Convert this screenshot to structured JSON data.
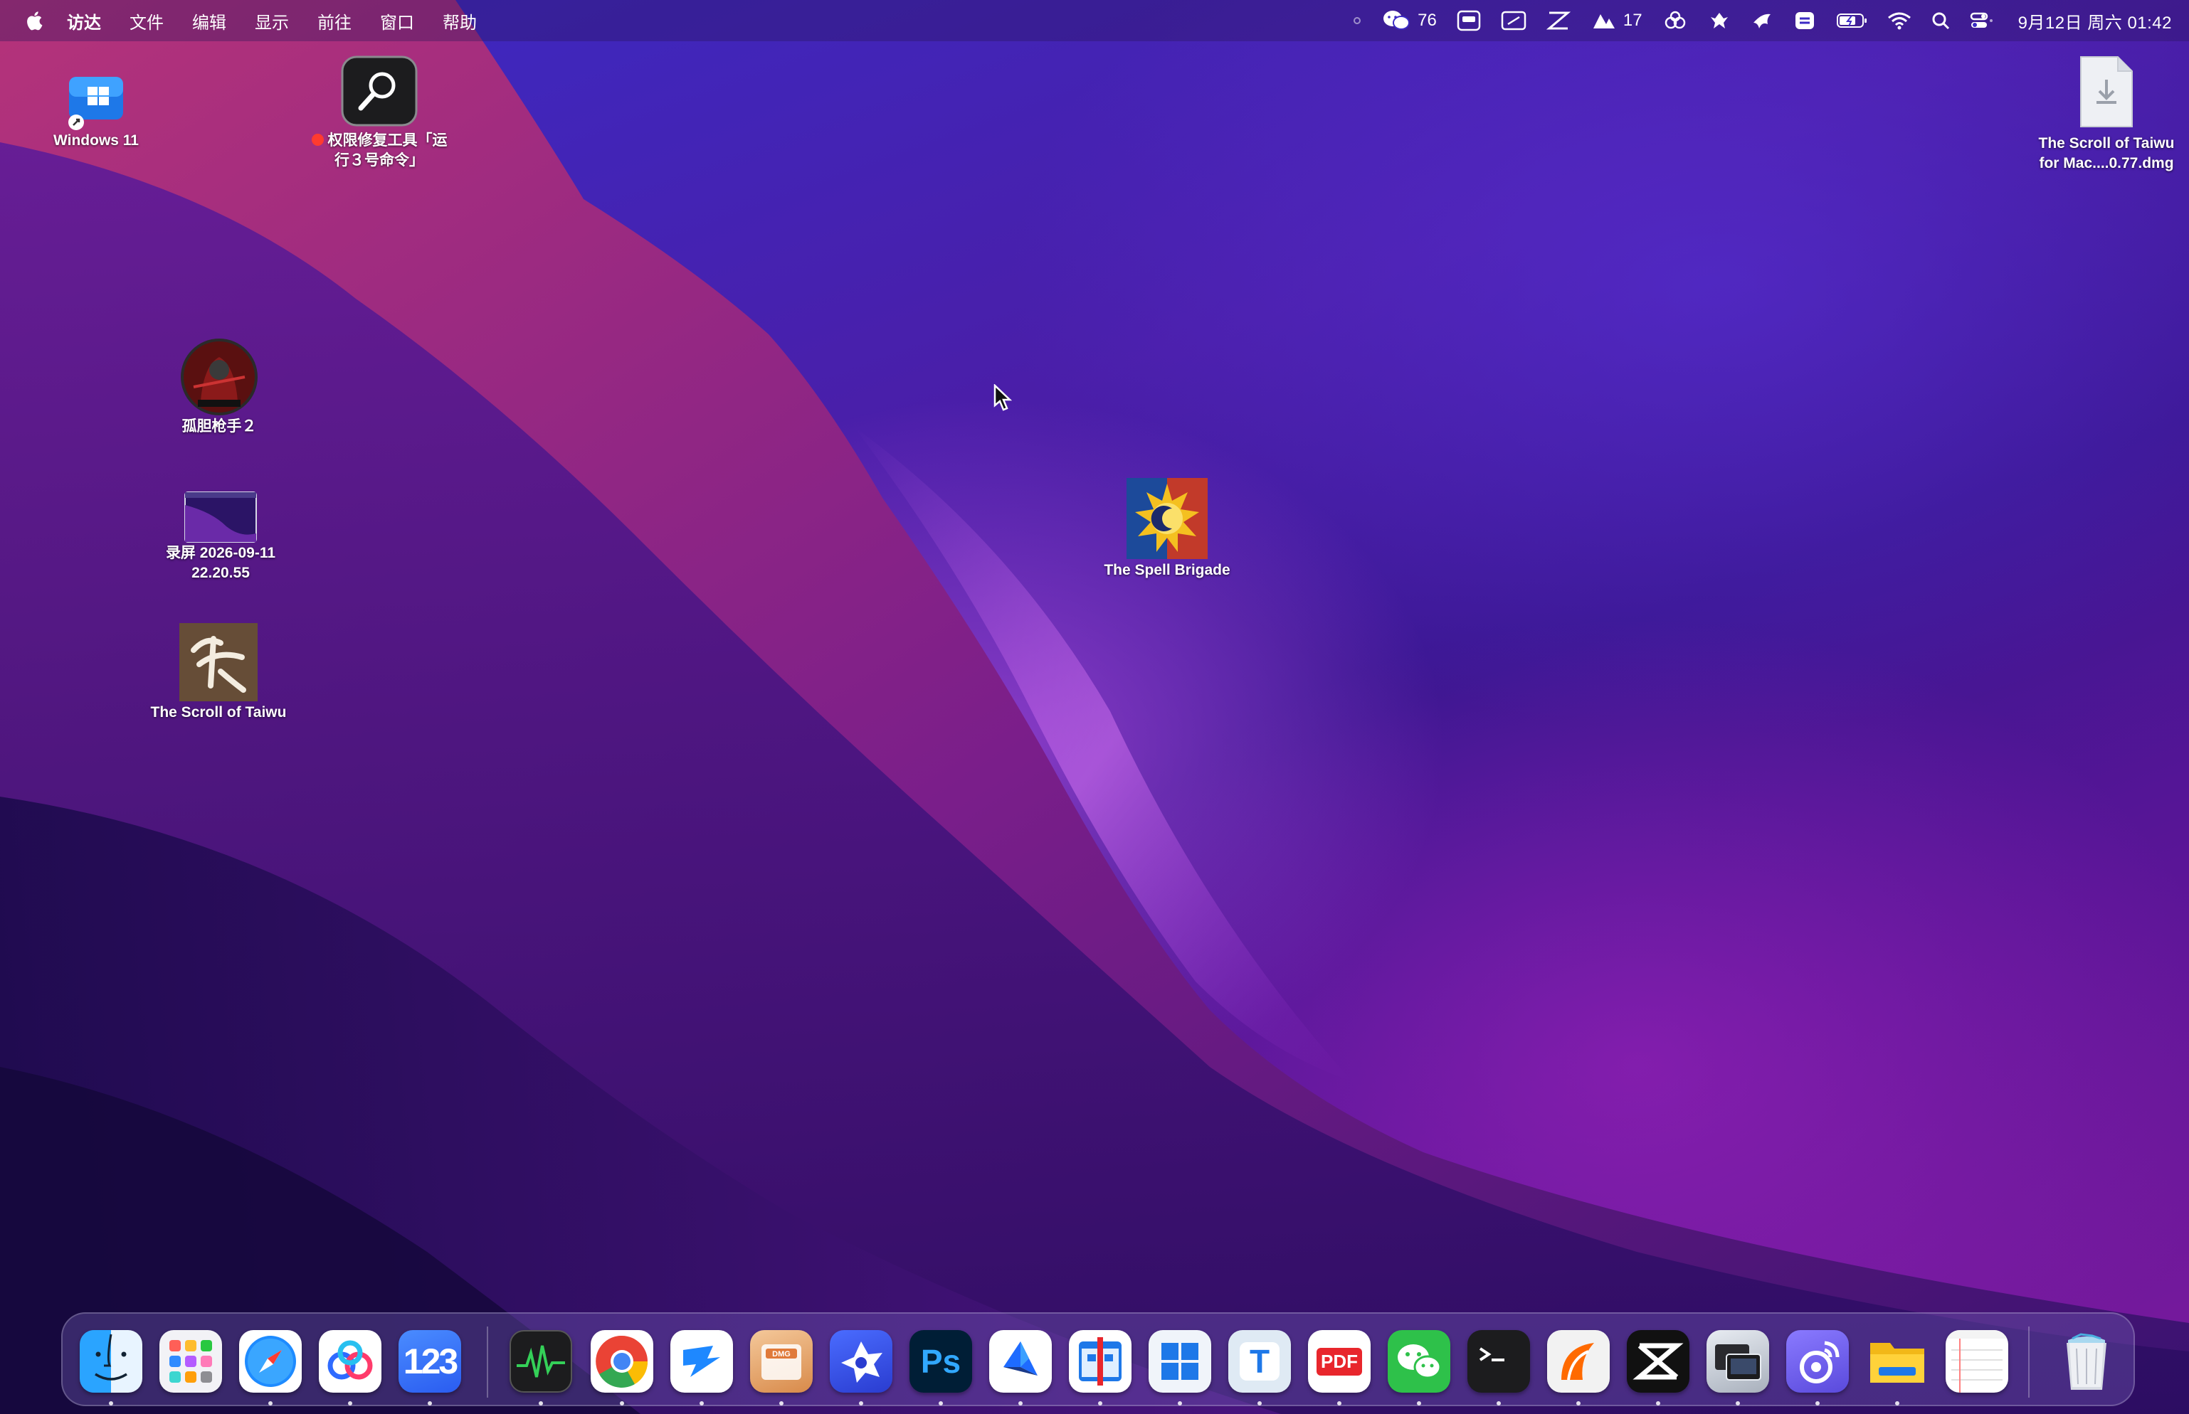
{
  "menubar": {
    "app_name": "访达",
    "menus": [
      "文件",
      "编辑",
      "显示",
      "前往",
      "窗口",
      "帮助"
    ],
    "wechat_count": "76",
    "user_count": "17",
    "datetime": "9月12日 周六 01:42"
  },
  "desktop": {
    "windows11": "Windows 11",
    "repair_tool_line1": "权限修复工具「运",
    "repair_tool_line2": "行３号命令」",
    "lone_gunner": "孤胆枪手２",
    "recording_line1": "录屏 2026-09-11",
    "recording_line2": "22.20.55",
    "scroll_taiwu": "The Scroll of Taiwu",
    "spell_brigade": "The Spell Brigade",
    "dmg_line1": "The Scroll of Taiwu",
    "dmg_line2": "for Mac....0.77.dmg"
  },
  "dock": {
    "icons": [
      "finder-icon",
      "launchpad-icon",
      "safari-icon",
      "baidu-netdisk-icon",
      "123-pan-icon",
      "activity-monitor-icon",
      "chrome-icon",
      "teamviewer-icon",
      "dmg-canvas-icon",
      "sunflower-icon",
      "photoshop-icon",
      "feishu-icon",
      "parallels-icon",
      "windows-app-icon",
      "typora-icon",
      "pdf-expert-icon",
      "wechat-icon",
      "terminal-icon",
      "linkedin-sales-icon",
      "capcut-icon",
      "screens-icon",
      "weibo-icon",
      "folder-icon",
      "notes-icon",
      "trash-icon"
    ],
    "ps_label": "Ps",
    "pan_label": "123",
    "pdf_label": "PDF",
    "t_label": "T",
    "dmg_label": "DMG"
  },
  "colors": {
    "accent": "#2f6bff",
    "wallpaper": "#4a1ea8"
  }
}
